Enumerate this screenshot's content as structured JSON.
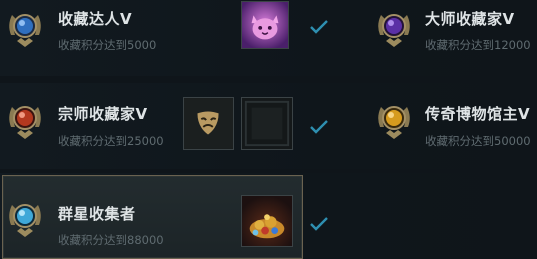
{
  "achievements": [
    {
      "title": "收藏达人Ⅴ",
      "requirement": "收藏积分达到5000",
      "completed": true,
      "gem_color": "#2f6fbf",
      "reward_icons": [
        "pink-cat-icon"
      ]
    },
    {
      "title": "大师收藏家Ⅴ",
      "requirement": "收藏积分达到12000",
      "completed": false,
      "gem_color": "#5a2fa6",
      "reward_icons": []
    },
    {
      "title": "宗师收藏家Ⅴ",
      "requirement": "收藏积分达到25000",
      "completed": true,
      "gem_color": "#b3381f",
      "reward_icons": [
        "theater-mask-icon",
        "dark-frame-icon"
      ]
    },
    {
      "title": "传奇博物馆主Ⅴ",
      "requirement": "收藏积分达到50000",
      "completed": false,
      "gem_color": "#d69b1e",
      "reward_icons": []
    },
    {
      "title": "群星收集者",
      "requirement": "收藏积分达到88000",
      "completed": true,
      "gem_color": "#3fa8d8",
      "reward_icons": [
        "treasure-pile-icon"
      ]
    }
  ],
  "colors": {
    "check": "#2e8fb0",
    "title": "#dfe4e6",
    "subtitle": "#5f6b70"
  }
}
